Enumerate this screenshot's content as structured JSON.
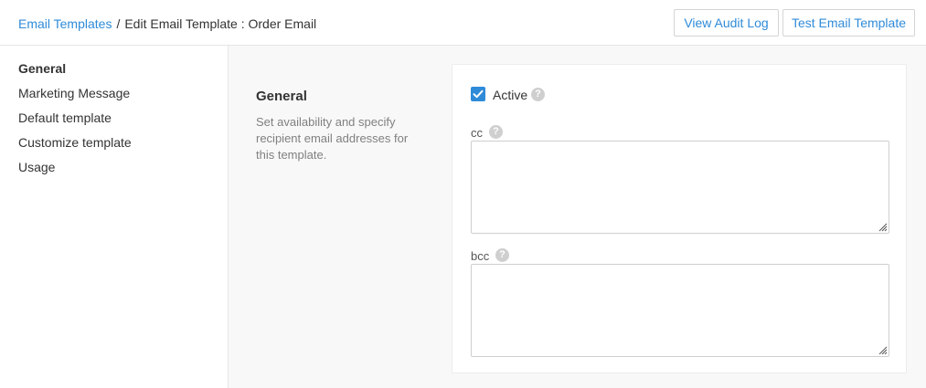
{
  "breadcrumb": {
    "parent": "Email Templates",
    "separator": "/",
    "current": "Edit Email Template : Order Email"
  },
  "header_actions": {
    "audit_label": "View Audit Log",
    "test_label": "Test Email Template"
  },
  "sidebar": {
    "items": [
      {
        "label": "General",
        "active": true
      },
      {
        "label": "Marketing Message",
        "active": false
      },
      {
        "label": "Default template",
        "active": false
      },
      {
        "label": "Customize template",
        "active": false
      },
      {
        "label": "Usage",
        "active": false
      }
    ]
  },
  "section": {
    "title": "General",
    "description": "Set availability and specify recipient email addresses for this template."
  },
  "form": {
    "active": {
      "label": "Active",
      "checked": true
    },
    "cc": {
      "label": "cc",
      "value": ""
    },
    "bcc": {
      "label": "bcc",
      "value": ""
    },
    "help_glyph": "?"
  },
  "colors": {
    "link": "#2f8bd8",
    "checkbox": "#2f8bd8",
    "background": "#f8f8f8"
  },
  "icons": [
    "checkmark-icon",
    "help-icon",
    "resize-handle-icon"
  ]
}
